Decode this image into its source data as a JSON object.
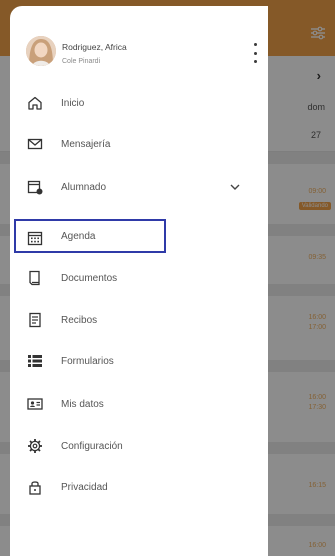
{
  "background": {
    "next_arrow": "›",
    "day_name": "dom",
    "day_number": "27",
    "events": [
      {
        "time": "09:00",
        "tag": "Validando"
      },
      {
        "time": "09:35"
      },
      {
        "time": "16:00",
        "time2": "17:00"
      },
      {
        "time": "16:00",
        "time2": "17:30"
      },
      {
        "time": "16:15"
      },
      {
        "time": "16:00"
      }
    ]
  },
  "drawer": {
    "profile": {
      "name": "Rodriguez, Africa",
      "subtitle": "Cole Pinardi"
    },
    "menu": [
      {
        "label": "Inicio",
        "icon": "home-icon"
      },
      {
        "label": "Mensajería",
        "icon": "mail-icon"
      },
      {
        "label": "Alumnado",
        "icon": "student-calendar-icon",
        "expandable": true
      },
      {
        "label": "Agenda",
        "icon": "calendar-icon",
        "selected": true
      },
      {
        "label": "Documentos",
        "icon": "document-icon"
      },
      {
        "label": "Recibos",
        "icon": "receipt-icon"
      },
      {
        "label": "Formularios",
        "icon": "form-list-icon"
      },
      {
        "label": "Mis datos",
        "icon": "id-card-icon"
      },
      {
        "label": "Configuración",
        "icon": "gear-icon"
      },
      {
        "label": "Privacidad",
        "icon": "lock-icon"
      }
    ]
  },
  "colors": {
    "accent": "#f3a34a",
    "selection_border": "#2f3aa8"
  }
}
